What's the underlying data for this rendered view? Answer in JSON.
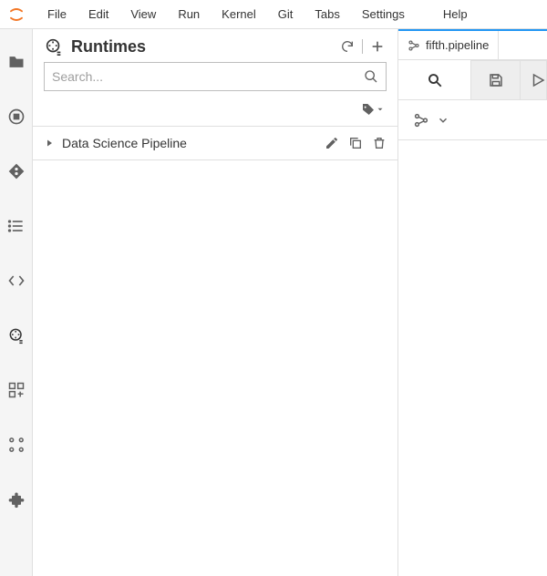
{
  "menu": {
    "file": "File",
    "edit": "Edit",
    "view": "View",
    "run": "Run",
    "kernel": "Kernel",
    "git": "Git",
    "tabs": "Tabs",
    "settings": "Settings",
    "help": "Help"
  },
  "panel": {
    "title": "Runtimes",
    "search_placeholder": "Search..."
  },
  "runtimes": {
    "items": [
      {
        "label": "Data Science Pipeline"
      }
    ]
  },
  "tab": {
    "filename": "fifth.pipeline"
  }
}
